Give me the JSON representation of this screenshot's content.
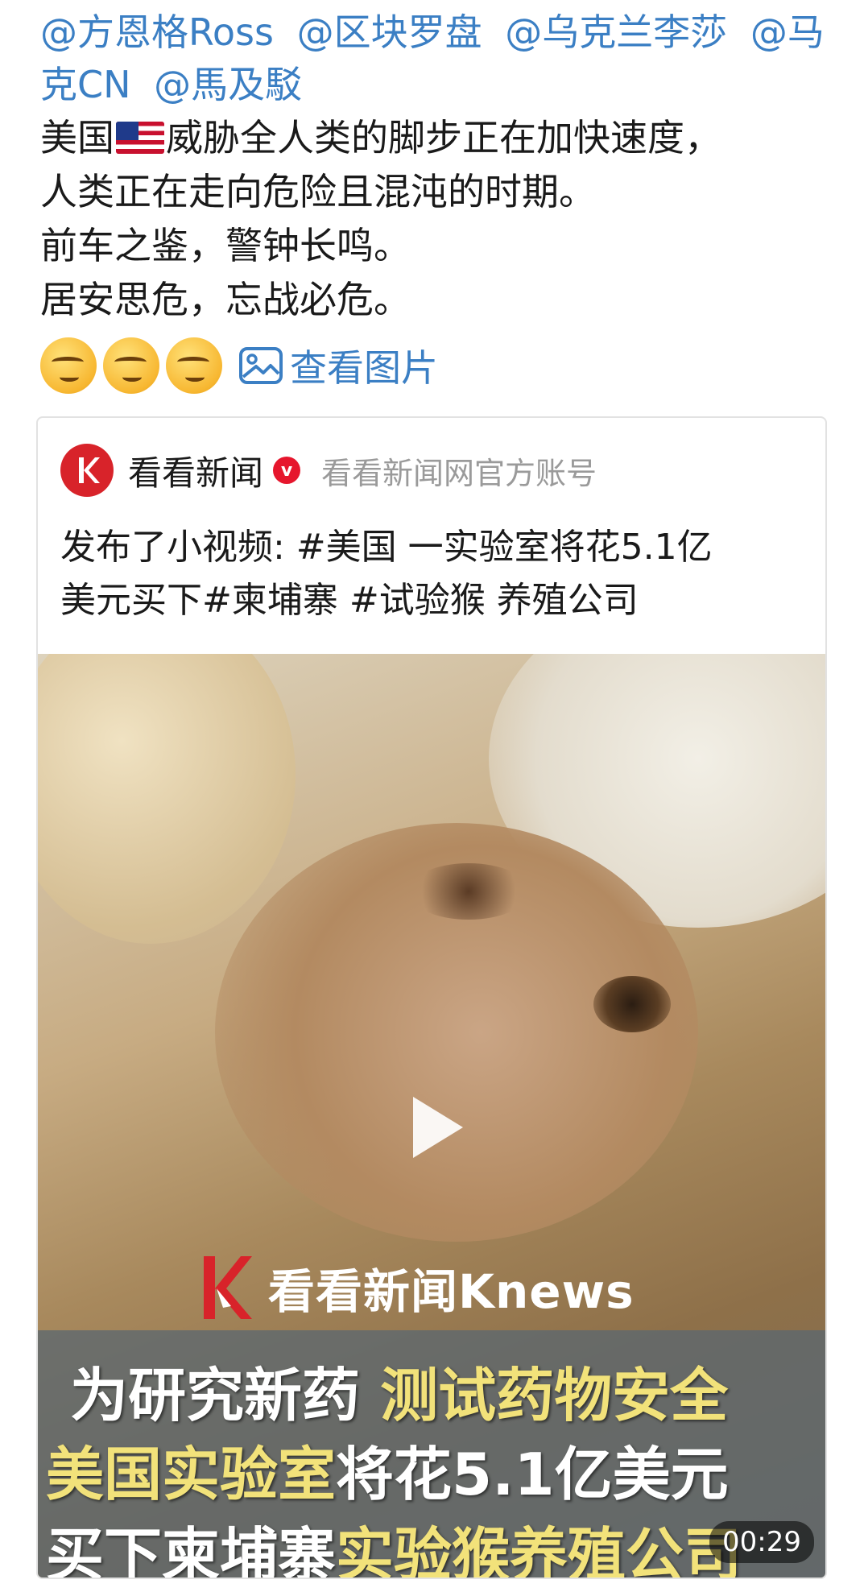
{
  "post": {
    "mentions": [
      "@方恩格Ross",
      "@区块罗盘",
      "@乌克兰李莎",
      "@马克CN",
      "@馬及駁"
    ],
    "text_line1_a": "美国",
    "text_line1_b": "威胁全人类的脚步正在加快速度，",
    "text_line2": "人类正在走向危险且混沌的时期。",
    "text_line3": "前车之鉴，警钟长鸣。",
    "text_line4": "居安思危，忘战必危。",
    "view_images_label": "查看图片"
  },
  "card": {
    "account_name": "看看新闻",
    "verified_badge": "v",
    "account_desc": "看看新闻网官方账号",
    "text_line1": "发布了小视频: #美国 一实验室将花5.1亿",
    "text_line2": "美元买下#柬埔寨 #试验猴 养殖公司"
  },
  "video": {
    "brand": "看看新闻Knews",
    "caption1_a": "为研究新药",
    "caption1_b": " 测试药物安全",
    "caption2_a": "美国实验室",
    "caption2_b": "将花5.1亿美元",
    "caption3_a": "买下柬埔寨",
    "caption3_b": "实验猴养殖公司",
    "duration": "00:29"
  },
  "colors": {
    "link": "#3b7fc4",
    "brand_red": "#d8232a",
    "caption_yellow": "#f2e27a"
  }
}
